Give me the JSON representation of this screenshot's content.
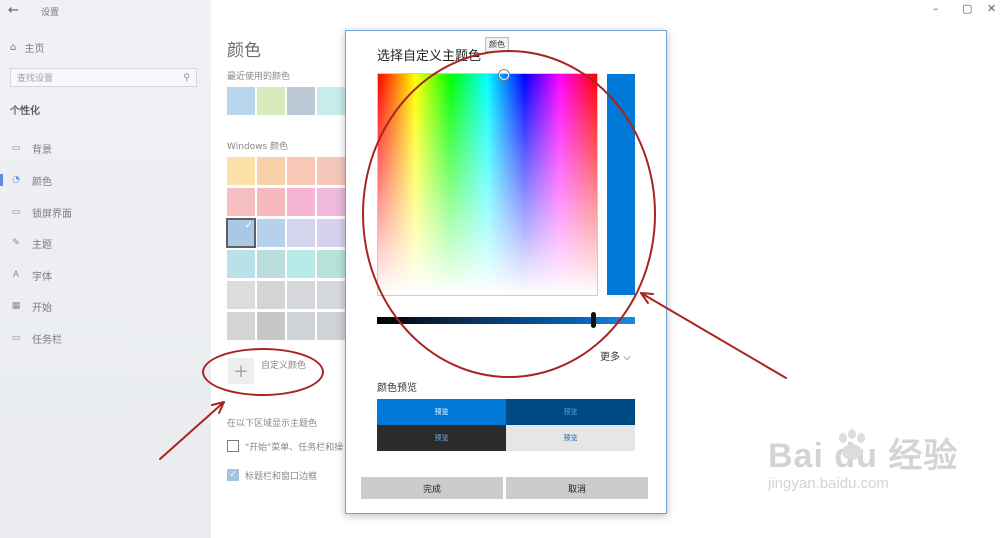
{
  "app": {
    "title": "设置",
    "back_glyph": "←"
  },
  "window_controls": {
    "minimize": "–",
    "maximize": "▢",
    "close": "✕"
  },
  "sidebar": {
    "home": {
      "icon": "⌂",
      "label": "主页"
    },
    "search": {
      "placeholder": "查找设置",
      "icon": "⚲"
    },
    "section": "个性化",
    "items": [
      {
        "icon": "▭",
        "label": "背景"
      },
      {
        "icon": "◔",
        "label": "颜色"
      },
      {
        "icon": "▭",
        "label": "锁屏界面"
      },
      {
        "icon": "✎",
        "label": "主题"
      },
      {
        "icon": "A",
        "label": "字体"
      },
      {
        "icon": "▦",
        "label": "开始"
      },
      {
        "icon": "▭",
        "label": "任务栏"
      }
    ]
  },
  "main": {
    "title": "颜色",
    "recent_label": "最近使用的颜色",
    "recent_colors": [
      "#a4c9ea",
      "#cbe4a8",
      "#a9b9c9",
      "#b7e7e6"
    ],
    "windows_label": "Windows 颜色",
    "windows_colors": [
      [
        "#fbd88f",
        "#f8c590",
        "#f6b8a0",
        "#f2b8a8"
      ],
      [
        "#f3aeb4",
        "#f3a6ac",
        "#f2a0c6",
        "#e9a6d0"
      ],
      [
        "#93b8df",
        "#a3c4e6",
        "#c8cbe9",
        "#cac5ea"
      ],
      [
        "#a6d9e5",
        "#a5d5d5",
        "#a5e5e3",
        "#a4d9d0"
      ],
      [
        "#d3d3d3",
        "#c8c8c8",
        "#c9ccd1",
        "#c9cdd3"
      ],
      [
        "#c7c8c9",
        "#b8b8b8",
        "#c3c7cc",
        "#c2c6cb"
      ]
    ],
    "custom_color_label": "自定义颜色",
    "plus_glyph": "+",
    "show_accent_label": "在以下区域显示主题色",
    "check_start_label": "\"开始\"菜单、任务栏和操",
    "check_titlebar_label": "标题栏和窗口边框",
    "check_mark": "✓"
  },
  "dialog": {
    "title": "选择自定义主题色",
    "tooltip": "颜色",
    "selected_color": "#0078d7",
    "more_label": "更多",
    "more_chevron": "⌵",
    "preview_label": "颜色预览",
    "previews": [
      {
        "text": "预览",
        "bg": "#0078d7",
        "fg": "#ffffff"
      },
      {
        "text": "预览",
        "bg": "#004a83",
        "fg": "#4fa3e8"
      },
      {
        "text": "预览",
        "bg": "#2b2b2b",
        "fg": "#6fb2f0"
      },
      {
        "text": "预览",
        "bg": "#e6e6e6",
        "fg": "#0067c0"
      }
    ],
    "done_label": "完成",
    "cancel_label": "取消"
  },
  "annotation_color": "#a8241e",
  "watermark": {
    "main": "Bai du 经验",
    "sub": "jingyan.baidu.com"
  }
}
